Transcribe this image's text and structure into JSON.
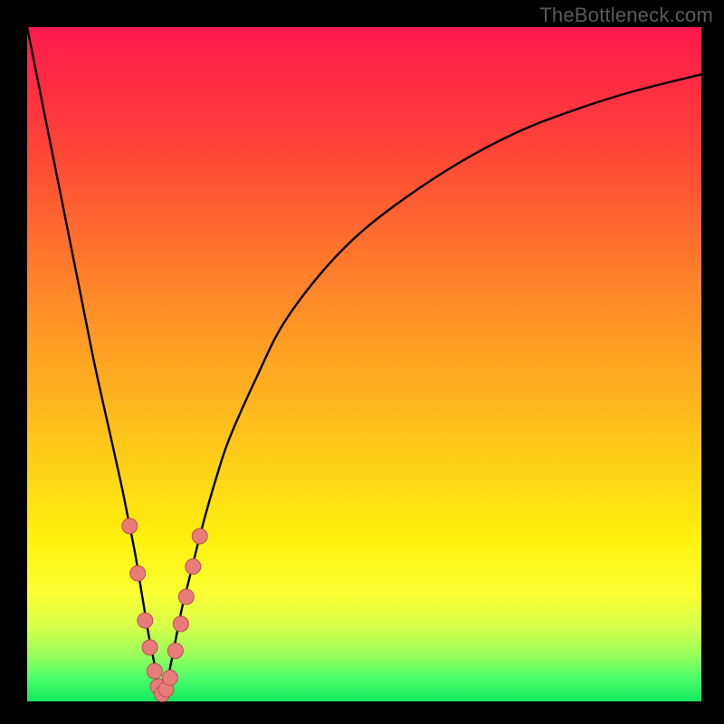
{
  "attribution": "TheBottleneck.com",
  "colors": {
    "frame": "#000000",
    "curve": "#000000",
    "marker_fill": "#e97b7b",
    "marker_stroke": "#b85151",
    "gradient_top": "#ff1a4d",
    "gradient_bottom": "#12e85f"
  },
  "chart_data": {
    "type": "line",
    "title": "",
    "xlabel": "",
    "ylabel": "",
    "xlim": [
      0,
      100
    ],
    "ylim": [
      0,
      100
    ],
    "grid": false,
    "legend": false,
    "series": [
      {
        "name": "bottleneck-curve",
        "x": [
          0,
          2,
          4,
          6,
          8,
          10,
          12,
          14,
          15,
          16,
          17,
          18,
          19,
          19.5,
          20,
          20.5,
          21,
          22,
          23,
          24,
          26,
          28,
          30,
          34,
          38,
          44,
          50,
          58,
          66,
          74,
          82,
          90,
          100
        ],
        "y": [
          100,
          90,
          80,
          70,
          60,
          50,
          41,
          32,
          27,
          22,
          16,
          10,
          5,
          2.5,
          1,
          2,
          4,
          9,
          14,
          18,
          26,
          33,
          39,
          48,
          56,
          64,
          70,
          76,
          81,
          85,
          88,
          90.5,
          93
        ]
      }
    ],
    "markers": [
      {
        "x": 15.2,
        "y": 26
      },
      {
        "x": 16.4,
        "y": 19
      },
      {
        "x": 17.5,
        "y": 12
      },
      {
        "x": 18.2,
        "y": 8
      },
      {
        "x": 18.9,
        "y": 4.5
      },
      {
        "x": 19.4,
        "y": 2.2
      },
      {
        "x": 20.0,
        "y": 1.1
      },
      {
        "x": 20.6,
        "y": 1.8
      },
      {
        "x": 21.2,
        "y": 3.5
      },
      {
        "x": 22.0,
        "y": 7.5
      },
      {
        "x": 22.8,
        "y": 11.5
      },
      {
        "x": 23.6,
        "y": 15.5
      },
      {
        "x": 24.6,
        "y": 20
      },
      {
        "x": 25.6,
        "y": 24.5
      }
    ]
  }
}
